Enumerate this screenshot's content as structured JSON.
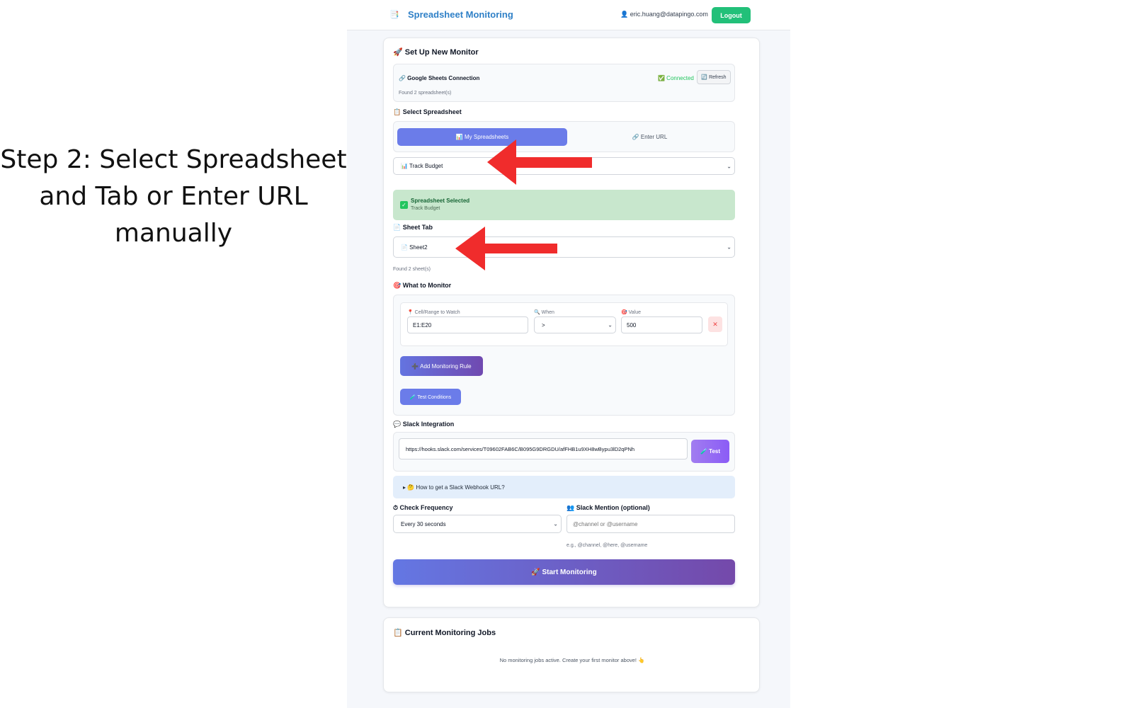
{
  "caption": [
    "Step 2: Select Spreadsheet",
    "and Tab or Enter URL",
    "manually"
  ],
  "header": {
    "brand_icon": "📑",
    "title": "Spreadsheet Monitoring",
    "user": "👤 eric.huang@datapingo.com",
    "logout_label": "Logout"
  },
  "setup": {
    "title": "🚀 Set Up New Monitor",
    "connection": {
      "title": "🔗 Google Sheets Connection",
      "status": "✅ Connected",
      "refresh_label": "🔄 Refresh",
      "found": "Found 2 spreadsheet(s)"
    },
    "select_spreadsheet": {
      "label": "📋 Select Spreadsheet",
      "tab_my": "📊 My Spreadsheets",
      "tab_url": "🔗 Enter URL",
      "selected_value": "📊 Track Budget"
    },
    "selected_notice": {
      "title": "Spreadsheet Selected",
      "name": "Track Budget"
    },
    "sheet_tab": {
      "label": "📄 Sheet Tab",
      "selected_value": "📄 Sheet2",
      "found": "Found 2 sheet(s)"
    },
    "monitor": {
      "label": "🎯 What to Monitor",
      "cell_label": "📍 Cell/Range to Watch",
      "cell_value": "E1:E20",
      "when_label": "🔍 When",
      "when_value": ">",
      "value_label": "🎯 Value",
      "value_value": "500",
      "remove_label": "✕",
      "add_label": "➕ Add Monitoring Rule",
      "test_label": "🧪 Test Conditions"
    },
    "slack": {
      "label": "💬 Slack Integration",
      "webhook_value": "https://hooks.slack.com/services/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",
      "test_label": "🧪 Test",
      "howto": "▸ 🤔 How to get a Slack Webhook URL?"
    },
    "frequency": {
      "label": "⏱ Check Frequency",
      "value": "Every 30 seconds"
    },
    "mention": {
      "label": "👥 Slack Mention (optional)",
      "placeholder": "@channel or @username",
      "hint": "e.g., @channel, @here, @username"
    },
    "start_label": "🚀 Start Monitoring"
  },
  "jobs": {
    "title": "📋 Current Monitoring Jobs",
    "empty": "No monitoring jobs active. Create your first monitor above! 👆"
  },
  "colors": {
    "accent": "#6b7ce9",
    "success": "#22c079",
    "arrow": "#f02c2c"
  }
}
